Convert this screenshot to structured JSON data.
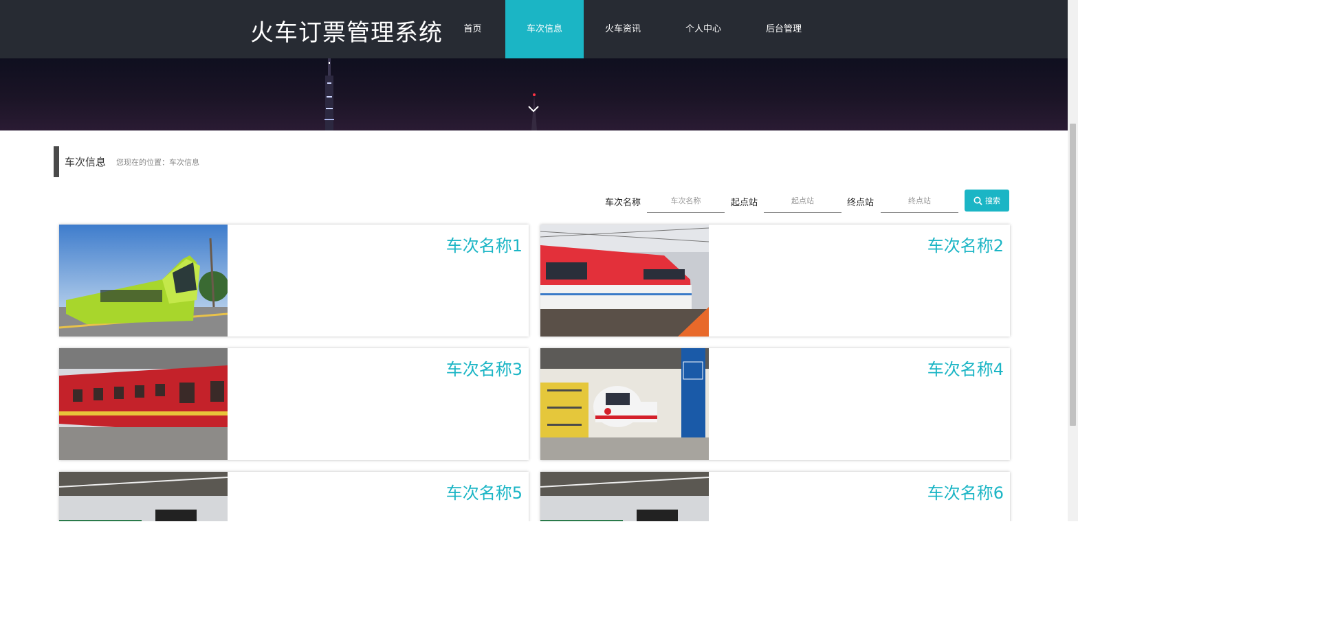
{
  "header": {
    "brand": "火车订票管理系统",
    "nav": [
      {
        "label": "首页"
      },
      {
        "label": "车次信息"
      },
      {
        "label": "火车资讯"
      },
      {
        "label": "个人中心"
      },
      {
        "label": "后台管理"
      }
    ],
    "active_nav": "车次信息",
    "background_color": "#272b33",
    "accent_color": "#1bb5c5"
  },
  "section": {
    "title": "车次信息",
    "breadcrumb": "您现在的位置：车次信息"
  },
  "search": {
    "train_name_label": "车次名称",
    "train_name_placeholder": "车次名称",
    "start_label": "起点站",
    "start_placeholder": "起点站",
    "end_label": "终点站",
    "end_placeholder": "终点站",
    "button_label": "搜索",
    "button_icon": "search-icon"
  },
  "trains": [
    {
      "name": "车次名称1",
      "image": "lime-green-tram-photo"
    },
    {
      "name": "车次名称2",
      "image": "red-white-train-photo"
    },
    {
      "name": "车次名称3",
      "image": "red-passenger-car-photo"
    },
    {
      "name": "车次名称4",
      "image": "metro-depot-photo"
    },
    {
      "name": "车次名称5",
      "image": "painted-subway-train-photo"
    },
    {
      "name": "车次名称6",
      "image": "painted-subway-train-photo"
    }
  ]
}
